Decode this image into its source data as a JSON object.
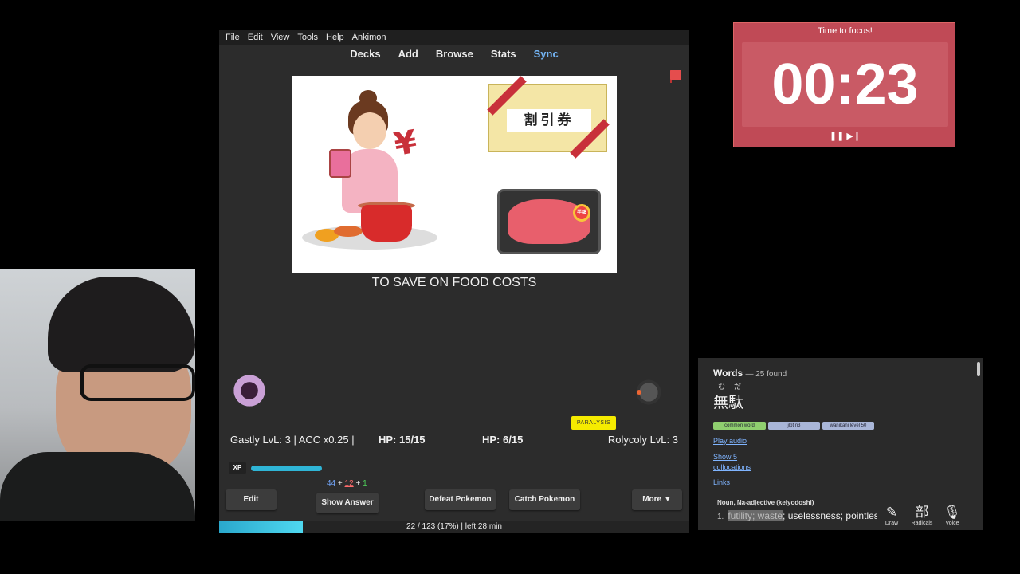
{
  "menu": [
    "File",
    "Edit",
    "View",
    "Tools",
    "Help",
    "Ankimon"
  ],
  "toolbar": {
    "decks": "Decks",
    "add": "Add",
    "browse": "Browse",
    "stats": "Stats",
    "sync": "Sync"
  },
  "card": {
    "coupon_text": "割引券",
    "yen_symbol": "¥",
    "sticker_text": "半額",
    "answer_text": "TO SAVE ON FOOD COSTS"
  },
  "battle": {
    "status_badge": "PARALYSIS",
    "left_stats": "Gastly LvL: 3 | ACC x0.25 |",
    "hp_player": "HP: 15/15",
    "hp_enemy": "HP: 6/15",
    "right_stats": "Rolycoly LvL: 3",
    "xp_label": "XP",
    "xp_fraction": 0.3
  },
  "counts": {
    "new": "44",
    "learning": "12",
    "review": "1",
    "plus": "+"
  },
  "buttons": {
    "edit": "Edit",
    "show_answer": "Show Answer",
    "defeat": "Defeat Pokemon",
    "catch": "Catch Pokemon",
    "more": "More ▼"
  },
  "progress": {
    "text": "22 / 123 (17%) | left 28 min",
    "fraction": 0.17
  },
  "timer": {
    "title": "Time to focus!",
    "time": "00:23",
    "controls": "❚❚ ▶❙"
  },
  "dictionary": {
    "heading": "Words",
    "found": "— 25 found",
    "furigana": "むだ",
    "word": "無駄",
    "tags": [
      "common word",
      "jlpt n3",
      "wanikani level 50"
    ],
    "play_audio": "Play audio",
    "show_collocations": "Show 5 collocations",
    "links": "Links",
    "pos": "Noun, Na-adjective (keiyodoshi)",
    "def_num": "1.",
    "def_highlight": "futility; waste",
    "def_rest": "; uselessness; pointless",
    "tools": [
      {
        "icon": "✎",
        "label": "Draw"
      },
      {
        "icon": "部",
        "label": "Radicals"
      },
      {
        "icon": "🎙",
        "label": "Voice"
      }
    ]
  }
}
